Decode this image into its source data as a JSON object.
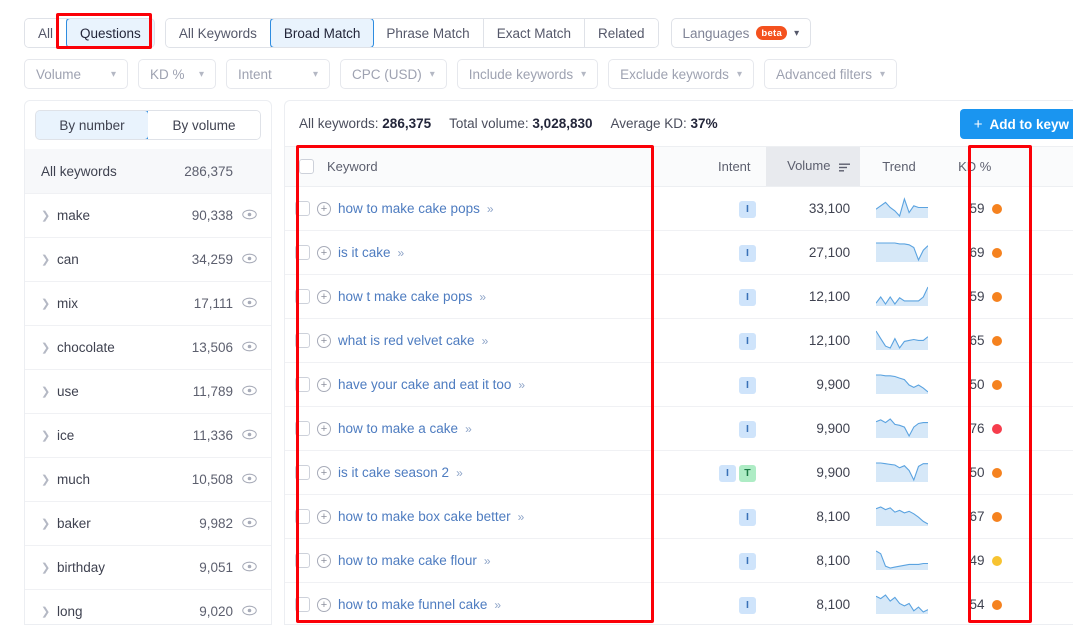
{
  "tabs": {
    "group1": [
      {
        "label": "All",
        "active": false
      },
      {
        "label": "Questions",
        "active": true
      }
    ],
    "group2": [
      {
        "label": "All Keywords",
        "active": false
      },
      {
        "label": "Broad Match",
        "active": true
      },
      {
        "label": "Phrase Match",
        "active": false
      },
      {
        "label": "Exact Match",
        "active": false
      },
      {
        "label": "Related",
        "active": false
      }
    ],
    "languages": {
      "label": "Languages",
      "badge": "beta",
      "caret": "chevron-down-icon"
    }
  },
  "filters": [
    {
      "label": "Volume",
      "width": "w-vol"
    },
    {
      "label": "KD %",
      "width": "w-kd"
    },
    {
      "label": "Intent",
      "width": "w-int"
    },
    {
      "label": "CPC (USD)",
      "width": ""
    },
    {
      "label": "Include keywords",
      "width": ""
    },
    {
      "label": "Exclude keywords",
      "width": ""
    },
    {
      "label": "Advanced filters",
      "width": ""
    }
  ],
  "sidebar": {
    "toggle": [
      {
        "label": "By number",
        "active": true
      },
      {
        "label": "By volume",
        "active": false
      }
    ],
    "all_keywords": {
      "label": "All keywords",
      "count": "286,375"
    },
    "items": [
      {
        "label": "make",
        "count": "90,338"
      },
      {
        "label": "can",
        "count": "34,259"
      },
      {
        "label": "mix",
        "count": "17,111"
      },
      {
        "label": "chocolate",
        "count": "13,506"
      },
      {
        "label": "use",
        "count": "11,789"
      },
      {
        "label": "ice",
        "count": "11,336"
      },
      {
        "label": "much",
        "count": "10,508"
      },
      {
        "label": "baker",
        "count": "9,982"
      },
      {
        "label": "birthday",
        "count": "9,051"
      },
      {
        "label": "long",
        "count": "9,020"
      }
    ]
  },
  "summary": {
    "all_keywords_label": "All keywords:",
    "all_keywords_value": "286,375",
    "total_volume_label": "Total volume:",
    "total_volume_value": "3,028,830",
    "average_kd_label": "Average KD:",
    "average_kd_value": "37%",
    "add_button": "Add to keyw"
  },
  "table": {
    "headers": {
      "keyword": "Keyword",
      "intent": "Intent",
      "volume": "Volume",
      "trend": "Trend",
      "kd": "KD %"
    },
    "rows": [
      {
        "keyword": "how to make cake pops",
        "intent": [
          "I"
        ],
        "volume": "33,100",
        "kd": "59",
        "kd_color": "#f5821f",
        "trend": "18,20,22,19,17,14,24,16,20,19,19,19"
      },
      {
        "keyword": "is it cake",
        "intent": [
          "I"
        ],
        "volume": "27,100",
        "kd": "69",
        "kd_color": "#f5821f",
        "trend": "27,27,27,27,27,26,26,25,22,8,19,24"
      },
      {
        "keyword": "how t make cake pops",
        "intent": [
          "I"
        ],
        "volume": "12,100",
        "kd": "59",
        "kd_color": "#f5821f",
        "trend": "6,14,5,14,5,13,9,9,9,9,14,27"
      },
      {
        "keyword": "what is red velvet cake",
        "intent": [
          "I"
        ],
        "volume": "12,100",
        "kd": "65",
        "kd_color": "#f5821f",
        "trend": "24,16,8,6,16,6,13,14,15,14,14,18"
      },
      {
        "keyword": "have your cake and eat it too",
        "intent": [
          "I"
        ],
        "volume": "9,900",
        "kd": "50",
        "kd_color": "#f5821f",
        "trend": "26,26,25,25,24,22,20,13,10,13,9,4"
      },
      {
        "keyword": "how to make a cake",
        "intent": [
          "I"
        ],
        "volume": "9,900",
        "kd": "76",
        "kd_color": "#f63d4c",
        "trend": "20,22,19,23,17,16,14,4,14,18,19,19"
      },
      {
        "keyword": "is it cake season 2",
        "intent": [
          "I",
          "T"
        ],
        "volume": "9,900",
        "kd": "50",
        "kd_color": "#f5821f",
        "trend": "27,27,26,25,24,20,23,16,2,22,26,26"
      },
      {
        "keyword": "how to make box cake better",
        "intent": [
          "I"
        ],
        "volume": "8,100",
        "kd": "67",
        "kd_color": "#f5821f",
        "trend": "22,24,21,23,18,20,17,19,16,12,7,4"
      },
      {
        "keyword": "how to make cake flour",
        "intent": [
          "I"
        ],
        "volume": "8,100",
        "kd": "49",
        "kd_color": "#f7c331",
        "trend": "25,22,8,6,7,8,9,10,10,10,11,11"
      },
      {
        "keyword": "how to make funnel cake",
        "intent": [
          "I"
        ],
        "volume": "8,100",
        "kd": "54",
        "kd_color": "#f5821f",
        "trend": "22,20,23,18,21,16,14,16,10,13,9,11"
      }
    ]
  },
  "annotations": {
    "questions_tab": "red-highlight-questions-tab",
    "keyword_column": "red-highlight-keyword-column",
    "kd_column": "red-highlight-kd-column"
  },
  "colors": {
    "accent": "#1a95f0",
    "annotation": "#fb0007",
    "link": "#4e7cc0",
    "kd_orange": "#f5821f",
    "kd_red": "#f63d4c",
    "kd_yellow": "#f7c331"
  }
}
